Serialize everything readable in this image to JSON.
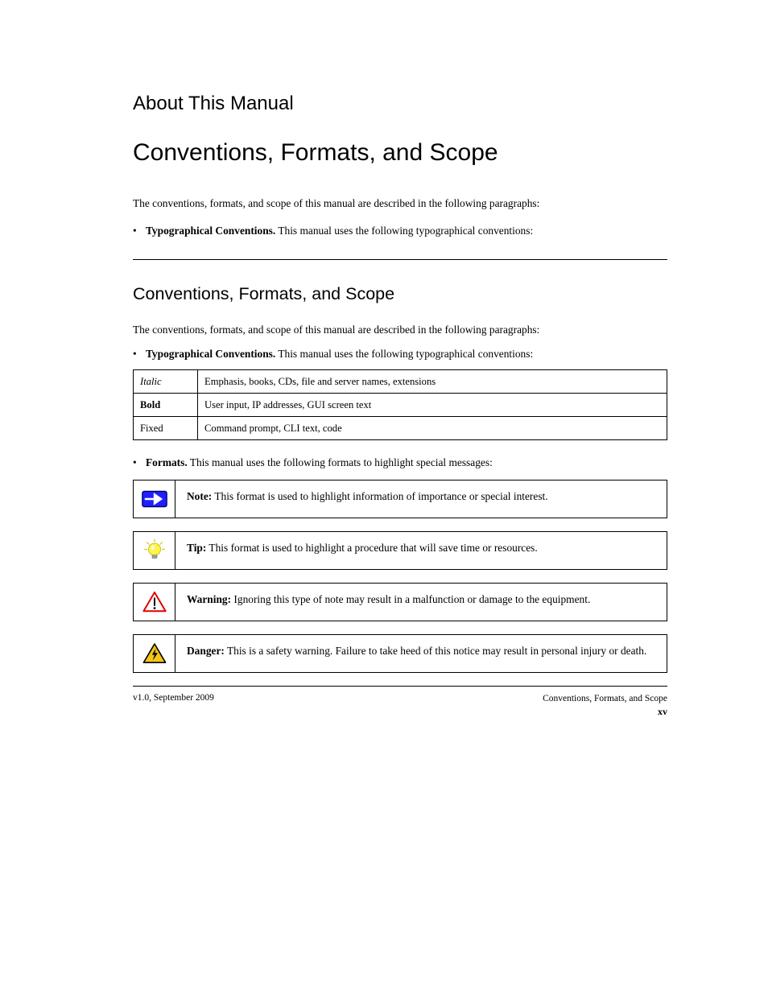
{
  "pretitle": "About This Manual",
  "title": "Conventions, Formats, and Scope",
  "intro": "The conventions, formats, and scope of this manual are described in the following paragraphs:",
  "bullets": [
    {
      "lead": "Typographical Conventions.",
      "rest": " This manual uses the following typographical conventions:"
    }
  ],
  "typo_table": [
    {
      "col1": "Italic",
      "style1": "italic",
      "col2": "Emphasis, books, CDs, file and server names, extensions"
    },
    {
      "col1": "Bold",
      "style1": "bold",
      "col2": "User input, IP addresses, GUI screen text"
    },
    {
      "col1": "Fixed",
      "style1": "fixed",
      "col2": "Command prompt, CLI text, code"
    }
  ],
  "formats_bullet": {
    "lead": "Formats.",
    "rest": " This manual uses the following formats to highlight special messages:"
  },
  "boxes": [
    {
      "icon": "note",
      "lead": "Note:",
      "text": " This format is used to highlight information of importance or special interest."
    },
    {
      "icon": "tip",
      "lead": "Tip:",
      "text": " This format is used to highlight a procedure that will save time or resources."
    },
    {
      "icon": "warning",
      "lead": "Warning:",
      "text": " Ignoring this type of note may result in a malfunction or damage to the equipment."
    },
    {
      "icon": "danger",
      "lead": "Danger:",
      "text": " This is a safety warning. Failure to take heed of this notice may result in personal injury or death."
    }
  ],
  "footer": {
    "left": "v1.0, September 2009",
    "right_top": "Conventions, Formats, and Scope",
    "right_page": "xv"
  }
}
